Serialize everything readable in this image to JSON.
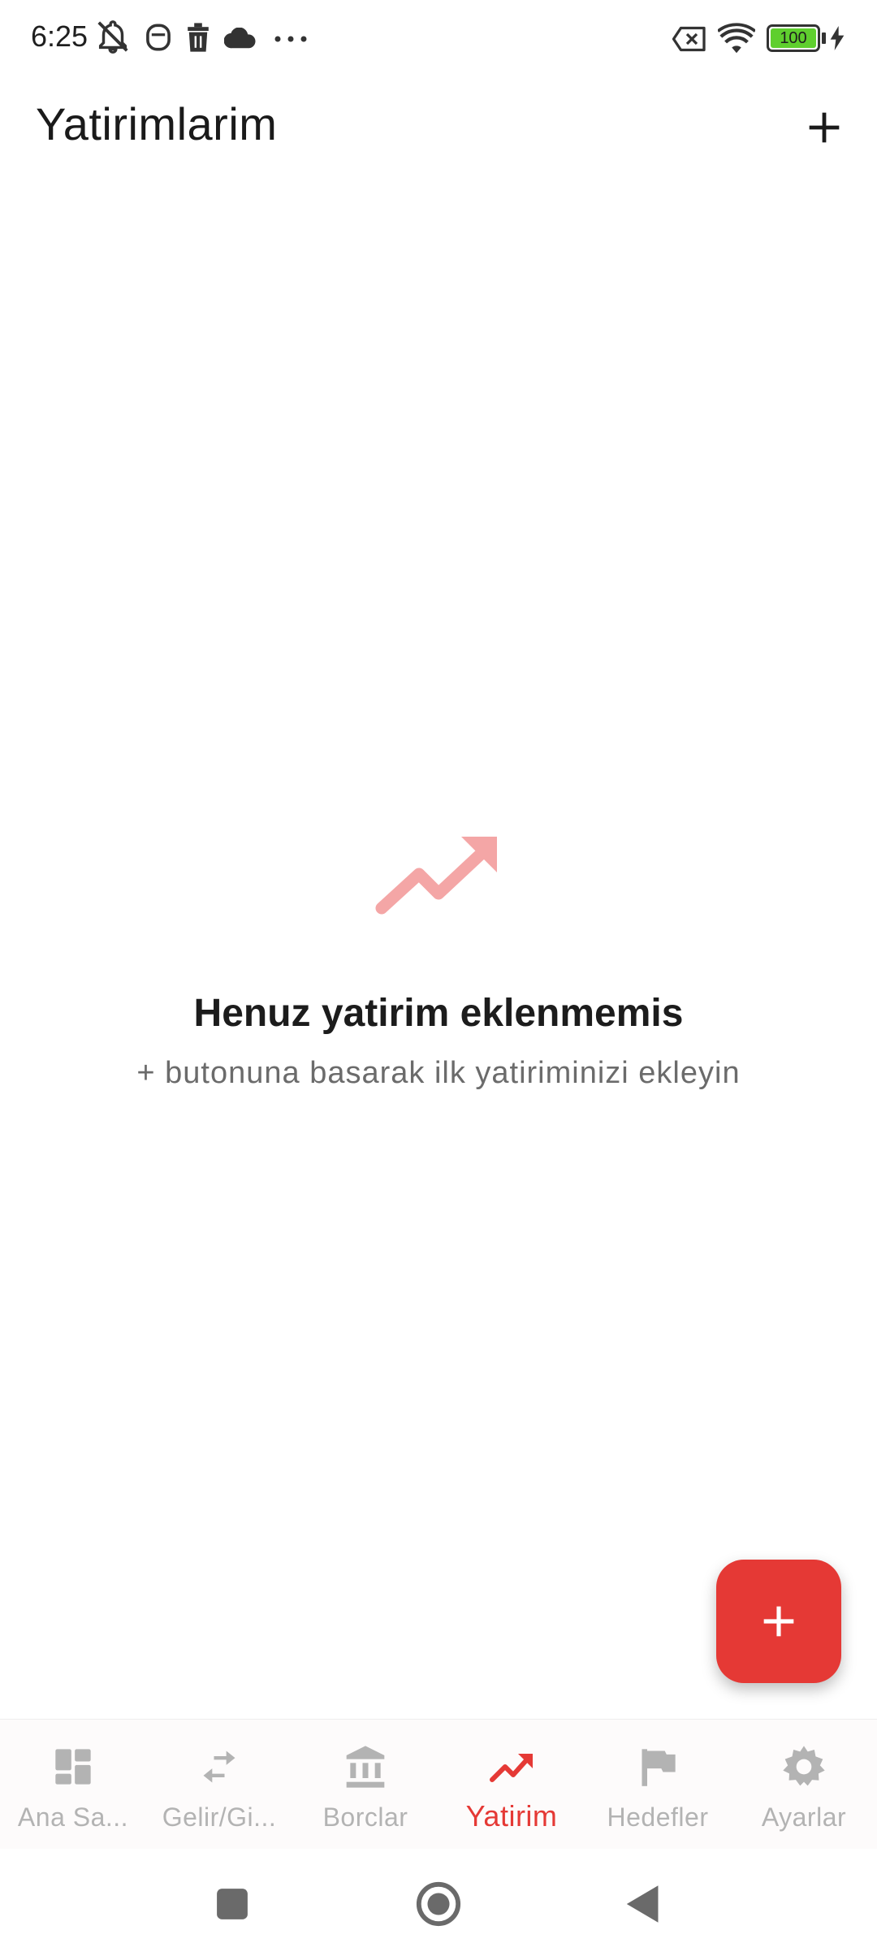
{
  "status_bar": {
    "time": "6:25",
    "battery": "100",
    "icons": [
      "muted-bell-icon",
      "face-icon",
      "trash-icon",
      "cloud-icon",
      "more-dots-icon",
      "sim-off-icon",
      "wifi-icon",
      "battery-icon",
      "charging-icon"
    ]
  },
  "app_bar": {
    "title": "Yatirimlarim",
    "add_icon": "plus-icon"
  },
  "empty_state": {
    "icon": "trending-up-icon",
    "title": "Henuz yatirim eklenmemis",
    "subtitle": "+ butonuna basarak ilk yatiriminizi ekleyin"
  },
  "fab": {
    "icon": "plus-icon"
  },
  "bottom_nav": {
    "items": [
      {
        "label": "Ana Sa...",
        "icon": "dashboard-icon",
        "active": false
      },
      {
        "label": "Gelir/Gi...",
        "icon": "swap-arrows-icon",
        "active": false
      },
      {
        "label": "Borclar",
        "icon": "bank-icon",
        "active": false
      },
      {
        "label": "Yatirim",
        "icon": "trending-up-icon",
        "active": true
      },
      {
        "label": "Hedefler",
        "icon": "flag-icon",
        "active": false
      },
      {
        "label": "Ayarlar",
        "icon": "gear-icon",
        "active": false
      }
    ]
  },
  "colors": {
    "accent": "#e53935",
    "empty_icon": "#f4a6a6",
    "inactive": "#b3b3b3",
    "battery_fill": "#5fcf2e"
  }
}
